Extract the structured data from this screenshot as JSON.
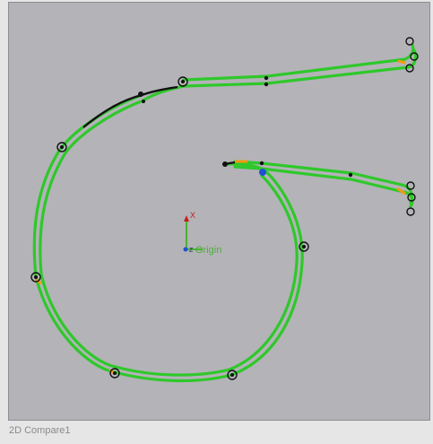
{
  "view": {
    "caption": "2D Compare1",
    "origin_label": "Origin",
    "axis_x_label": "X",
    "axis_z_label": "Z"
  },
  "colors": {
    "canvas_bg": "#b4b3b8",
    "profile_green": "#2ec82a",
    "profile_black": "#111111",
    "constraint_orange": "#f29a12",
    "point_blue": "#1f4fd6",
    "axis_red": "#c41e1e",
    "axis_green": "#49b233",
    "caption_text": "#8a8a8a"
  },
  "icons": {
    "sketch_point": "sketch-point-icon",
    "origin_triad": "origin-triad-icon"
  }
}
